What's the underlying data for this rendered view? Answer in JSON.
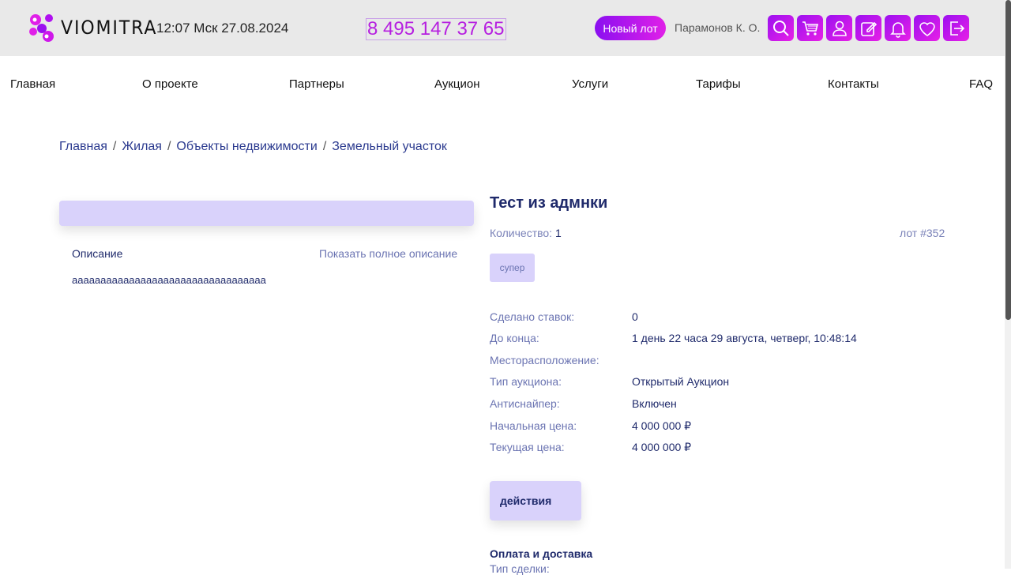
{
  "header": {
    "logo_text": "VIOMITRA",
    "clock": "12:07 Мск 27.08.2024",
    "phone": "8 495 147 37 65",
    "new_lot_label": "Новый лот",
    "user_name": "Парамонов К. О.",
    "icons": [
      "search-icon",
      "cart-icon",
      "user-icon",
      "edit-icon",
      "bell-icon",
      "heart-icon",
      "logout-icon"
    ],
    "accent_gradient": [
      "#9b10f0",
      "#e820e6"
    ]
  },
  "nav": {
    "items": [
      "Главная",
      "О проекте",
      "Партнеры",
      "Аукцион",
      "Услуги",
      "Тарифы",
      "Контакты",
      "FAQ"
    ]
  },
  "breadcrumb": {
    "items": [
      "Главная",
      "Жилая",
      "Объекты недвижимости",
      "Земельный участок"
    ],
    "separator": "/"
  },
  "description": {
    "title": "Описание",
    "show_full": "Показать полное описание",
    "text": "аааааааааааааааааааааааааааааааааа"
  },
  "lot": {
    "title": "Тест из адмнки",
    "quantity_label": "Количество:",
    "quantity_value": "1",
    "lot_number": "лот #352",
    "tag": "супер",
    "details": [
      {
        "label": "Сделано ставок:",
        "value": "0"
      },
      {
        "label": "До конца:",
        "value": "1 день 22 часа 29 августа, четверг, 10:48:14"
      },
      {
        "label": "Месторасположение:",
        "value": ""
      },
      {
        "label": "Тип аукциона:",
        "value": "Открытый Аукцион"
      },
      {
        "label": "Антиснайпер:",
        "value": "Включен"
      },
      {
        "label": "Начальная цена:",
        "value": "4 000 000 ₽"
      },
      {
        "label": "Текущая цена:",
        "value": "4 000 000 ₽"
      }
    ],
    "actions_label": "действия",
    "payment_title": "Оплата и доставка",
    "deal_type_label": "Тип сделки:"
  }
}
